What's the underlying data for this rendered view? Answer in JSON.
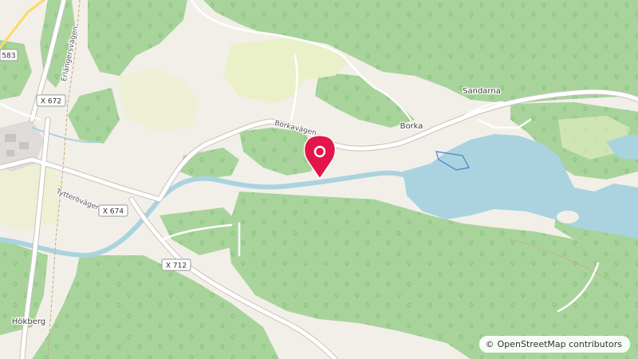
{
  "map": {
    "colors": {
      "forest": "#a8d49b",
      "forest_tree": "#7fb877",
      "farmland": "#eef0d5",
      "meadow": "#eaf0c8",
      "residential": "#e0dfdf",
      "background": "#f2efe9",
      "water": "#aad3df",
      "river": "#aad3df",
      "road_major": "#ffffff",
      "road_casing": "#c8c3bb",
      "marker": "#e2164a"
    },
    "marker_icon": "map-pin-icon"
  },
  "places": {
    "sandarna": "Sandarna",
    "borka": "Borka",
    "hokberg": "Hökberg"
  },
  "roads": {
    "borkavagen": "Borkavägen",
    "erlangersvagen": "Erlängersvägen",
    "tytterovagen": "Tytterövägen"
  },
  "shields": {
    "r583": "583",
    "x672": "X 672",
    "x674": "X 674",
    "x712": "X 712"
  },
  "attribution": {
    "symbol": "©",
    "text": "OpenStreetMap contributors"
  }
}
